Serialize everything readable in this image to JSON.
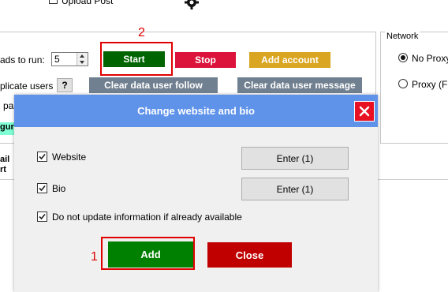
{
  "top": {
    "upload_post_label": "Upload Post"
  },
  "settings": {
    "threads_label": "ads to run:",
    "threads_value": "5",
    "duplicate_users_label": "plicate users",
    "help_label": "?",
    "pass_label": "pas",
    "config_tab_label": "gura"
  },
  "toolbar": {
    "start_label": "Start",
    "stop_label": "Stop",
    "add_account_label": "Add account",
    "clear_follow_label": "Clear data user follow",
    "clear_message_label": "Clear data user message"
  },
  "network": {
    "legend": "Network",
    "no_proxy_label": "No Proxy",
    "proxy_label": "Proxy (Fr"
  },
  "table": {
    "col_email_line1": "ail",
    "col_email_line2": "rt"
  },
  "annotations": {
    "step2": "2",
    "step1": "1"
  },
  "dialog": {
    "title": "Change website and bio",
    "website_label": "Website",
    "website_enter_label": "Enter (1)",
    "bio_label": "Bio",
    "bio_enter_label": "Enter (1)",
    "no_update_label": "Do not update information if already available",
    "add_label": "Add",
    "close_label": "Close"
  },
  "colors": {
    "title_bar": "#5f93ea",
    "start": "#006400",
    "stop": "#dc143c",
    "add_account": "#daa520",
    "clear": "#708090",
    "add": "#008000",
    "close": "#c00000",
    "highlight": "#e00000"
  }
}
